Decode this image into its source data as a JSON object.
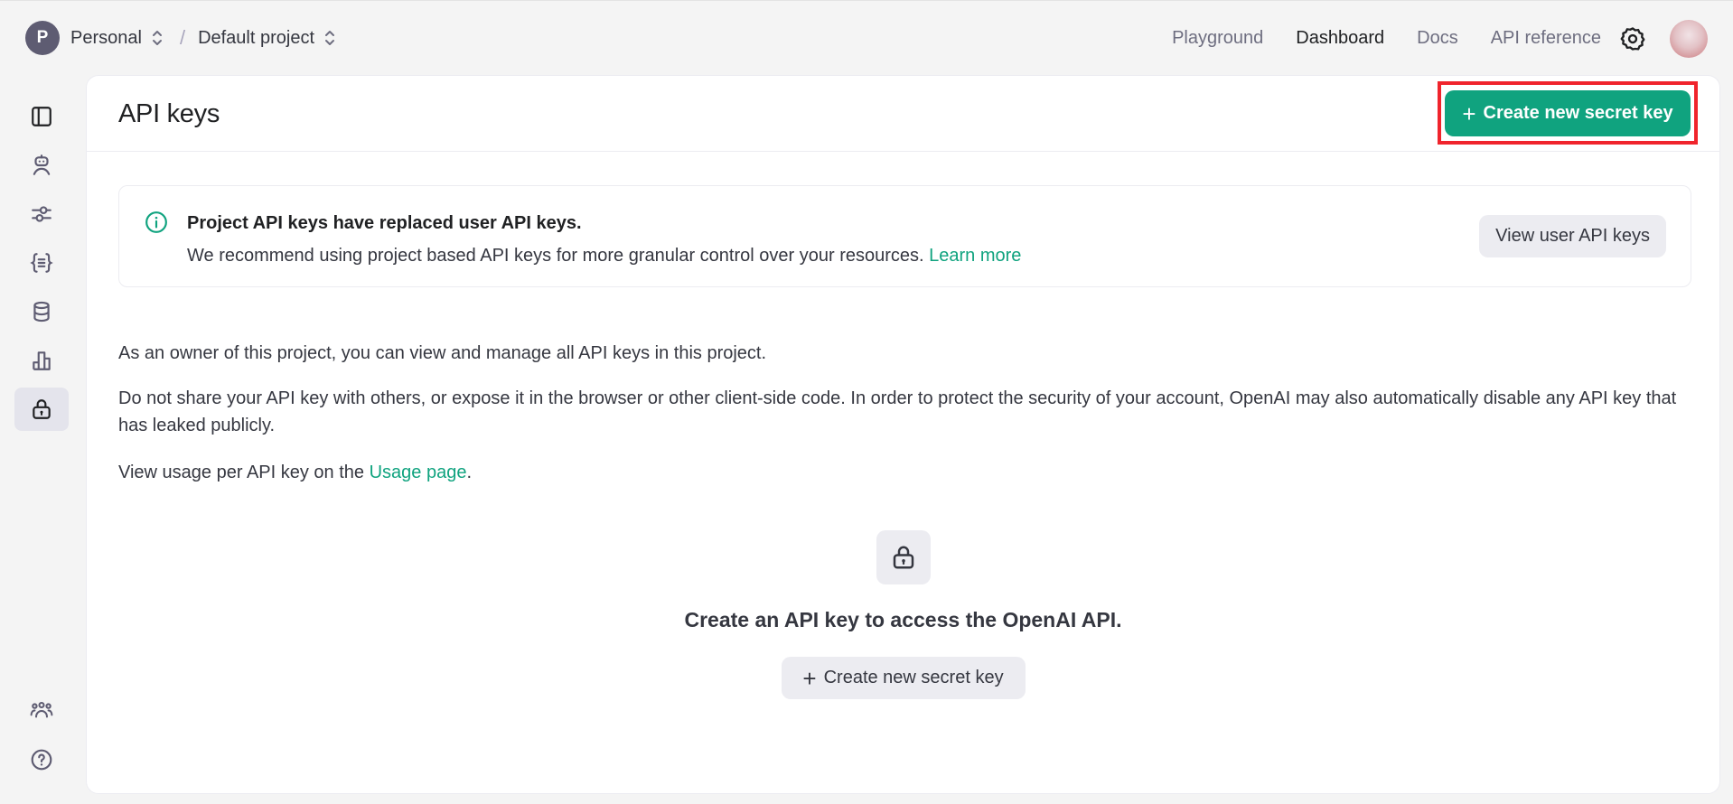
{
  "topbar": {
    "org_initial": "P",
    "org_name": "Personal",
    "separator": "/",
    "project_name": "Default project",
    "nav": [
      {
        "label": "Playground",
        "active": false
      },
      {
        "label": "Dashboard",
        "active": true
      },
      {
        "label": "Docs",
        "active": false
      },
      {
        "label": "API reference",
        "active": false
      }
    ],
    "settings_icon": "gear-icon",
    "avatar_icon": "user-avatar"
  },
  "sidebar": {
    "items": [
      {
        "icon": "sidebar-toggle-icon",
        "active": false
      },
      {
        "icon": "assistants-robot-icon",
        "active": false
      },
      {
        "icon": "fine-tuning-sliders-icon",
        "active": false
      },
      {
        "icon": "batches-braces-icon",
        "active": false
      },
      {
        "icon": "storage-database-icon",
        "active": false
      },
      {
        "icon": "usage-chart-icon",
        "active": false
      },
      {
        "icon": "api-keys-lock-icon",
        "active": true
      }
    ],
    "bottom_items": [
      {
        "icon": "team-users-icon"
      },
      {
        "icon": "help-question-icon"
      }
    ]
  },
  "main": {
    "title": "API keys",
    "create_button": {
      "plus": "+",
      "label": "Create new secret key"
    },
    "notice": {
      "icon": "info-icon",
      "title": "Project API keys have replaced user API keys.",
      "body": "We recommend using project based API keys for more granular control over your resources.",
      "link": "Learn more",
      "button": "View user API keys"
    },
    "paragraphs": {
      "owner": "As an owner of this project, you can view and manage all API keys in this project.",
      "warning": "Do not share your API key with others, or expose it in the browser or other client-side code. In order to protect the security of your account, OpenAI may also automatically disable any API key that has leaked publicly.",
      "usage_prefix": "View usage per API key on the ",
      "usage_link": "Usage page",
      "usage_suffix": "."
    },
    "empty_state": {
      "icon": "lock-icon",
      "text": "Create an API key to access the OpenAI API.",
      "button": {
        "plus": "+",
        "label": "Create new secret key"
      }
    }
  },
  "colors": {
    "accent": "#10a37f",
    "highlight": "#f0242c",
    "background": "#f4f4f4",
    "muted_button": "#ececf1"
  }
}
